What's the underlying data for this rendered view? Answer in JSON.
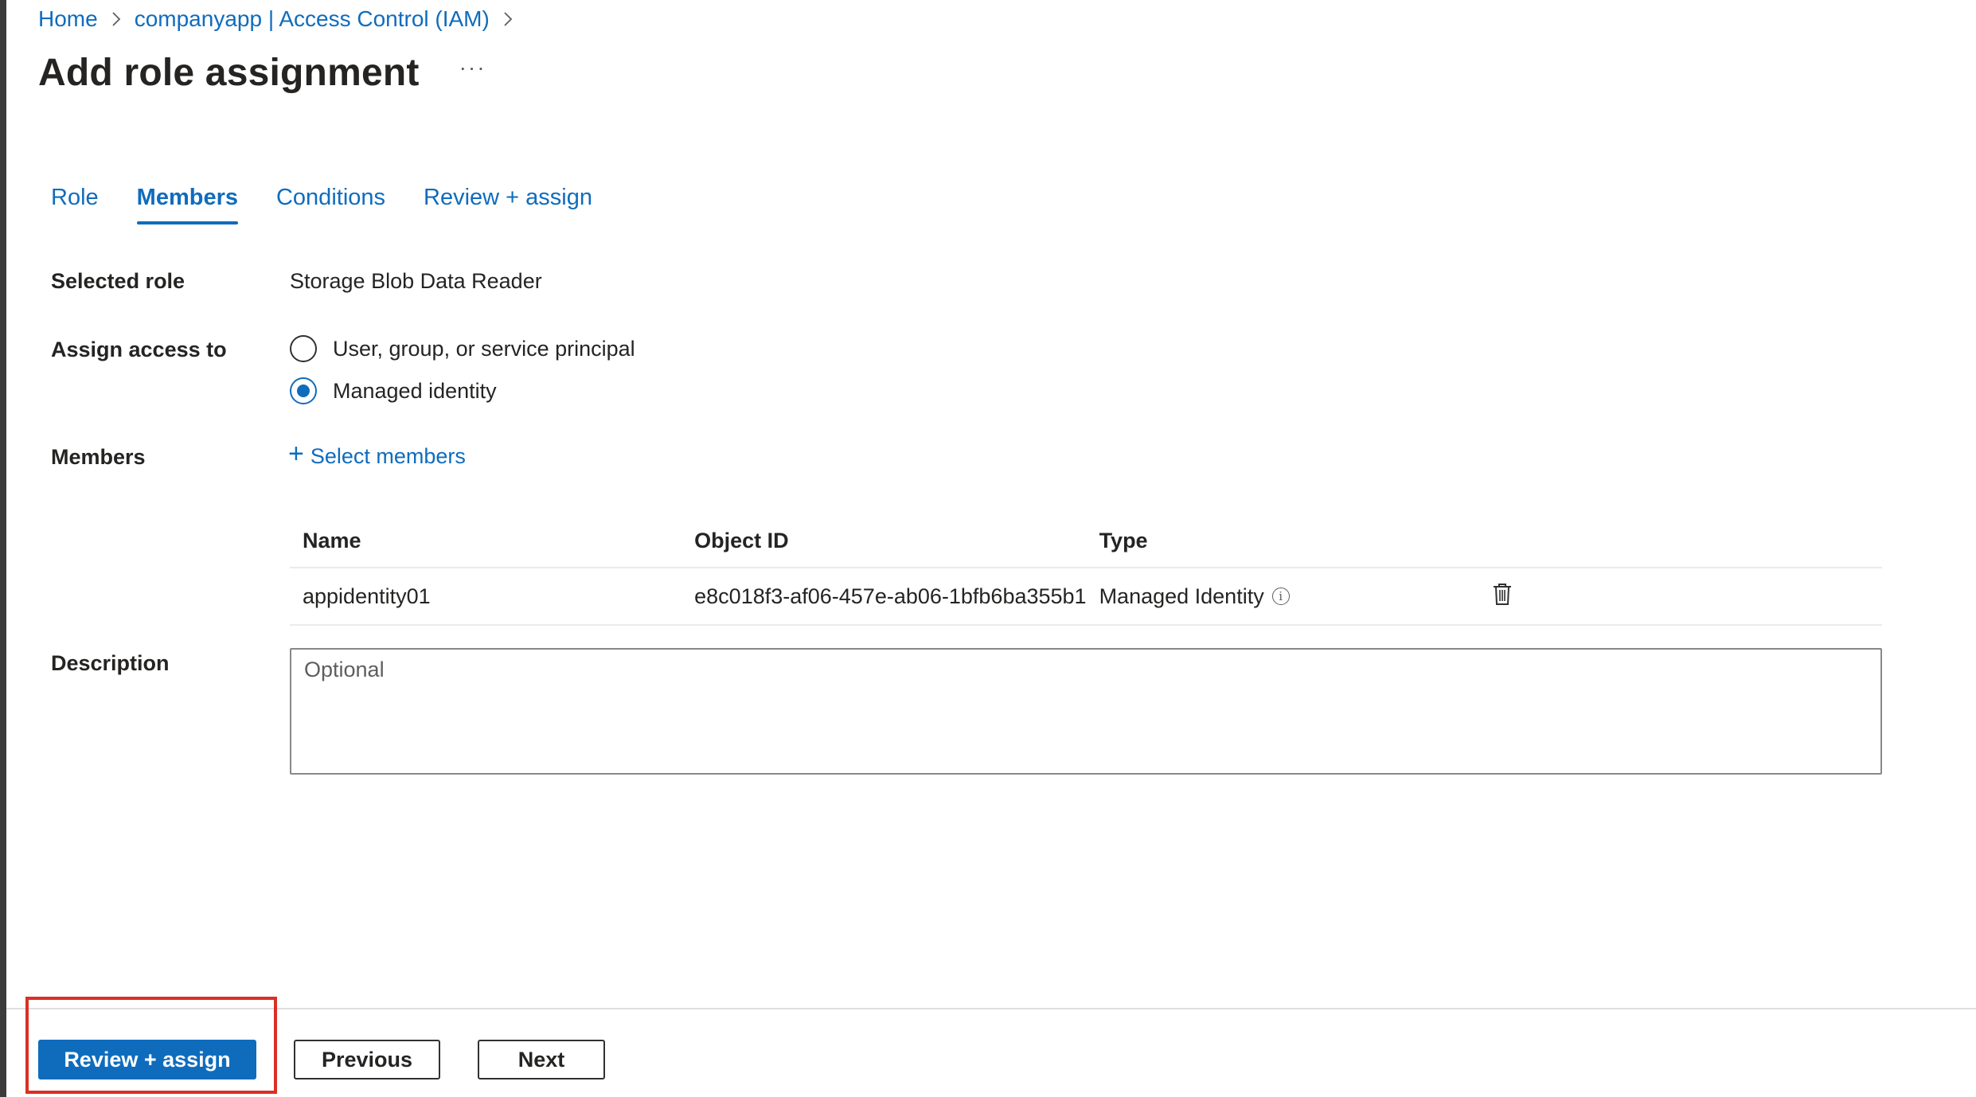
{
  "breadcrumb": {
    "items": [
      "Home",
      "companyapp | Access Control (IAM)"
    ],
    "separator": ">"
  },
  "page": {
    "title": "Add role assignment",
    "more_label": "···"
  },
  "tabs": [
    {
      "label": "Role",
      "active": false
    },
    {
      "label": "Members",
      "active": true
    },
    {
      "label": "Conditions",
      "active": false
    },
    {
      "label": "Review + assign",
      "active": false
    }
  ],
  "form": {
    "selected_role": {
      "label": "Selected role",
      "value": "Storage Blob Data Reader"
    },
    "assign_access": {
      "label": "Assign access to",
      "options": [
        {
          "label": "User, group, or service principal",
          "checked": false
        },
        {
          "label": "Managed identity",
          "checked": true
        }
      ]
    },
    "members": {
      "label": "Members",
      "select_label": "Select members",
      "columns": [
        "Name",
        "Object ID",
        "Type"
      ],
      "rows": [
        {
          "name": "appidentity01",
          "object_id": "e8c018f3-af06-457e-ab06-1bfb6ba355b1",
          "type": "Managed Identity"
        }
      ]
    },
    "description": {
      "label": "Description",
      "placeholder": "Optional",
      "value": ""
    }
  },
  "footer": {
    "review_assign_label": "Review + assign",
    "previous_label": "Previous",
    "next_label": "Next"
  },
  "colors": {
    "accent": "#0f6cbd",
    "highlight": "#d93025"
  },
  "icons": [
    "chevron-right-icon",
    "more-icon",
    "plus-icon",
    "info-icon",
    "trash-icon"
  ]
}
